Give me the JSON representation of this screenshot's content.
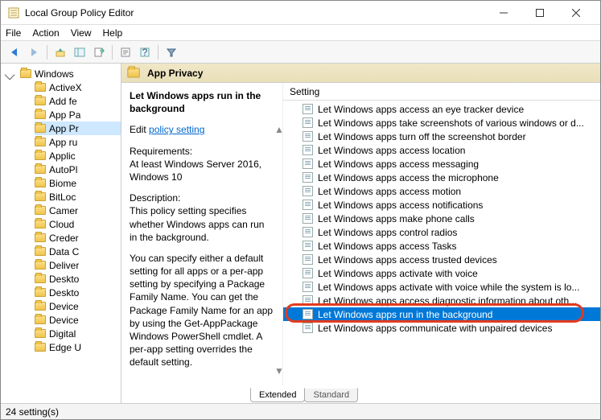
{
  "window": {
    "title": "Local Group Policy Editor"
  },
  "menu": {
    "file": "File",
    "action": "Action",
    "view": "View",
    "help": "Help"
  },
  "tree": {
    "root": "Windows",
    "items": [
      "ActiveX",
      "Add fe",
      "App Pa",
      "App Pr",
      "App ru",
      "Applic",
      "AutoPl",
      "Biome",
      "BitLoc",
      "Camer",
      "Cloud",
      "Creder",
      "Data C",
      "Deliver",
      "Deskto",
      "Deskto",
      "Device",
      "Device",
      "Digital",
      "Edge U"
    ],
    "selected_index": 3
  },
  "category": {
    "title": "App Privacy"
  },
  "detail": {
    "title": "Let Windows apps run in the background",
    "edit_prefix": "Edit ",
    "edit_link": "policy setting",
    "req_label": "Requirements:",
    "req_text": "At least Windows Server 2016, Windows 10",
    "desc_label": "Description:",
    "desc_text": "This policy setting specifies whether Windows apps can run in the background.",
    "desc_text2": "You can specify either a default setting for all apps or a per-app setting by specifying a Package Family Name. You can get the Package Family Name for an app by using the Get-AppPackage Windows PowerShell cmdlet. A per-app setting overrides the default setting."
  },
  "settings": {
    "column": "Setting",
    "items": [
      "Let Windows apps access an eye tracker device",
      "Let Windows apps take screenshots of various windows or d...",
      "Let Windows apps turn off the screenshot border",
      "Let Windows apps access location",
      "Let Windows apps access messaging",
      "Let Windows apps access the microphone",
      "Let Windows apps access motion",
      "Let Windows apps access notifications",
      "Let Windows apps make phone calls",
      "Let Windows apps control radios",
      "Let Windows apps access Tasks",
      "Let Windows apps access trusted devices",
      "Let Windows apps activate with voice",
      "Let Windows apps activate with voice while the system is lo...",
      "Let Windows apps access diagnostic information about oth...",
      "Let Windows apps run in the background",
      "Let Windows apps communicate with unpaired devices"
    ],
    "selected_index": 15
  },
  "tabs": {
    "extended": "Extended",
    "standard": "Standard"
  },
  "status": {
    "text": "24 setting(s)"
  }
}
